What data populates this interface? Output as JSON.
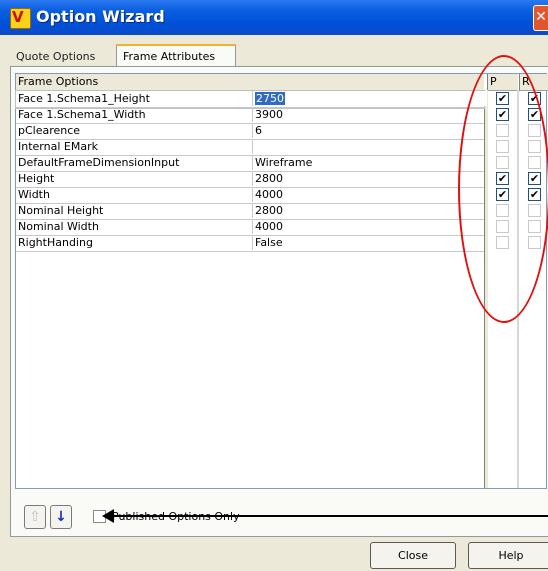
{
  "window": {
    "title": "Option Wizard",
    "icon": "app-icon",
    "close_glyph": "✕"
  },
  "tabs": [
    {
      "label": "Quote Options",
      "selected": false
    },
    {
      "label": "Frame Attributes",
      "selected": true
    }
  ],
  "grid": {
    "header": {
      "name_col": "Frame Options",
      "p_col": "P",
      "r_col": "R"
    },
    "rows": [
      {
        "name": "Face 1.Schema1_Height",
        "value": "2750",
        "p": true,
        "r": true
      },
      {
        "name": "Face 1.Schema1_Width",
        "value": "3900",
        "p": true,
        "r": true
      },
      {
        "name": "pClearence",
        "value": "6",
        "p": false,
        "r": false
      },
      {
        "name": "Internal EMark",
        "value": "",
        "p": false,
        "r": false
      },
      {
        "name": "DefaultFrameDimensionInput",
        "value": "Wireframe",
        "p": false,
        "r": false
      },
      {
        "name": "Height",
        "value": "2800",
        "p": true,
        "r": true
      },
      {
        "name": "Width",
        "value": "4000",
        "p": true,
        "r": true
      },
      {
        "name": "Nominal Height",
        "value": "2800",
        "p": false,
        "r": false
      },
      {
        "name": "Nominal Width",
        "value": "4000",
        "p": false,
        "r": false
      },
      {
        "name": "RightHanding",
        "value": "False",
        "p": false,
        "r": false
      }
    ]
  },
  "controls": {
    "up_arrow_glyph": "⇧",
    "down_arrow_glyph": "↓",
    "published_only_label": "Published Options Only",
    "published_only_checked": false
  },
  "buttons": {
    "close": "Close",
    "help": "Help"
  },
  "colors": {
    "titlebar": "#0a5ee0",
    "annotation": "#e01010",
    "selection": "#316ac5"
  }
}
